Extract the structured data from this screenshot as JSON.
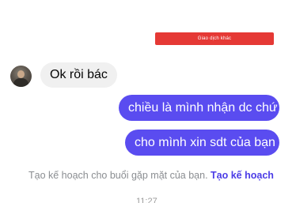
{
  "top_button": {
    "label": "Giao dịch khác",
    "color": "#e53935"
  },
  "messages": [
    {
      "direction": "incoming",
      "text": "Ok rồi bác"
    },
    {
      "direction": "outgoing",
      "text": "chiều là mình nhận dc chứ"
    },
    {
      "direction": "outgoing",
      "text": "cho mình xin sdt của bạn"
    }
  ],
  "plan_prompt": {
    "text": "Tạo kế hoạch cho buổi gặp mặt của bạn.",
    "link_label": "Tạo kế hoạch"
  },
  "timestamp": "11:27",
  "colors": {
    "outgoing_bubble": "#5a4cf0",
    "incoming_bubble": "#f0f0f0",
    "link": "#4b3ce6"
  }
}
